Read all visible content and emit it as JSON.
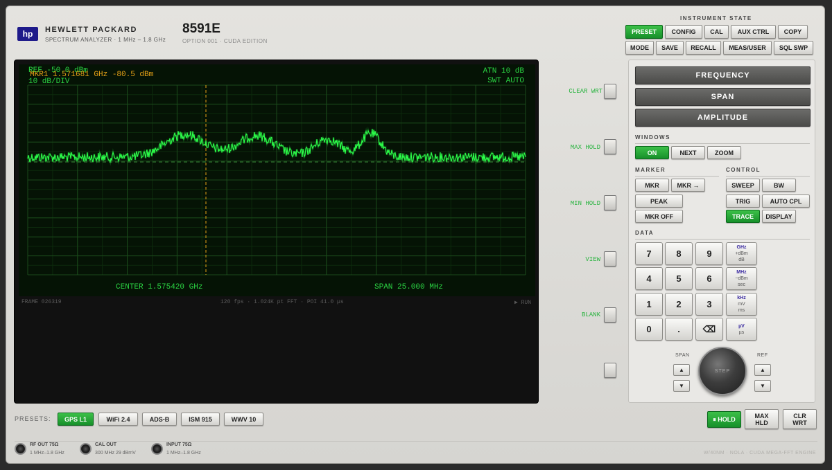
{
  "header": {
    "logo": "hp",
    "brand": "HEWLETT PACKARD",
    "subtitle": "SPECTRUM ANALYZER · 1 MHz – 1.8 GHz",
    "model": "8591E",
    "model_sub": "OPTION 001 · CUDA EDITION"
  },
  "instrument_state": {
    "title": "INSTRUMENT STATE",
    "row1": [
      "PRESET",
      "CONFIG",
      "CAL",
      "AUX CTRL",
      "COPY"
    ],
    "row2": [
      "MODE",
      "SAVE",
      "RECALL",
      "MEAS/USER",
      "SQL SWP"
    ]
  },
  "screen": {
    "ref": "REF -50.0 dBm",
    "marker": "MKR1  1.571681 GHz  -80.5 dBm",
    "scale": "10 dB/DIV",
    "atten": "ATN 10 dB",
    "sweep": "SWT AUTO",
    "center": "CENTER  1.575420 GHz",
    "span": "SPAN  25.000 MHz",
    "frame": "FRAME 026319",
    "stats": "120 fps · 1.024K pt FFT · POI 41.0 µs",
    "run": "▶ RUN",
    "trace_color": "#2cff4a",
    "marker_color": "#e8a317"
  },
  "softkeys": [
    "CLEAR WRT",
    "MAX HOLD",
    "MIN HOLD",
    "VIEW",
    "BLANK",
    ""
  ],
  "main_keys": [
    "FREQUENCY",
    "SPAN",
    "AMPLITUDE"
  ],
  "windows": {
    "title": "WINDOWS",
    "buttons": [
      "ON",
      "NEXT",
      "ZOOM"
    ]
  },
  "marker": {
    "title": "MARKER",
    "buttons": [
      "MKR",
      "MKR →",
      "PEAK",
      "MKR OFF"
    ]
  },
  "control": {
    "title": "CONTROL",
    "buttons": [
      "SWEEP",
      "BW",
      "TRIG",
      "AUTO CPL",
      "TRACE",
      "DISPLAY"
    ]
  },
  "data": {
    "title": "DATA",
    "keys": [
      "7",
      "8",
      "9",
      "4",
      "5",
      "6",
      "1",
      "2",
      "3",
      "0",
      ".",
      "⌫"
    ],
    "units": [
      {
        "top": "GHz",
        "mid": "+dBm",
        "bot": "dB"
      },
      {
        "top": "MHz",
        "mid": "−dBm",
        "bot": "sec"
      },
      {
        "top": "kHz",
        "mid": "mV",
        "bot": "ms"
      },
      {
        "top": "µV",
        "mid": "µs",
        "bot": ""
      }
    ]
  },
  "knob": {
    "label": "STEP",
    "left_label": "SPAN",
    "right_label": "REF"
  },
  "presets": {
    "label": "PRESETS:",
    "items": [
      "GPS L1",
      "WiFi 2.4",
      "ADS-B",
      "ISM 915",
      "WWV 10"
    ]
  },
  "hold_buttons": [
    "⏸ HOLD",
    "MAX HLD",
    "CLR WRT"
  ],
  "jacks": [
    {
      "title": "RF OUT 75Ω",
      "sub": "1 MHz–1.8 GHz"
    },
    {
      "title": "CAL OUT",
      "sub": "300 MHz 29 dBmV"
    },
    {
      "title": "INPUT 75Ω",
      "sub": "1 MHz–1.8 GHz"
    }
  ],
  "footer": "W/40NM · NOLA · CUDA MEGA-FFT ENGINE"
}
